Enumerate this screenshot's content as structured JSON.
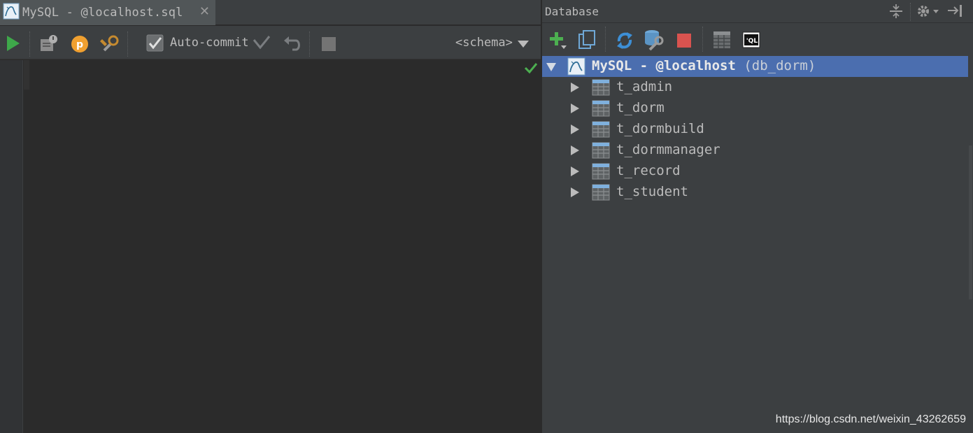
{
  "editor": {
    "tab_title": "MySQL - @localhost.sql",
    "toolbar": {
      "autocommit_label": "Auto-commit",
      "schema_label": "<schema>"
    }
  },
  "database": {
    "panel_title": "Database",
    "tree": {
      "root": {
        "name": "MySQL - @localhost",
        "extra": "(db_dorm)"
      },
      "tables": [
        "t_admin",
        "t_dorm",
        "t_dormbuild",
        "t_dormmanager",
        "t_record",
        "t_student"
      ]
    }
  },
  "watermark": "https://blog.csdn.net/weixin_43262659",
  "icons": {
    "run": "run-icon",
    "explain": "explain-plan-icon",
    "parameters": "parameters-icon",
    "settings": "datasource-settings-icon",
    "commit": "commit-icon",
    "rollback": "rollback-icon",
    "stop": "stop-icon",
    "dropdown": "chevron-down-icon"
  },
  "colors": {
    "selection": "#4b6eaf",
    "run_green": "#3ea84a",
    "stop_red": "#d9534f",
    "sync_blue": "#3d8fd6"
  }
}
